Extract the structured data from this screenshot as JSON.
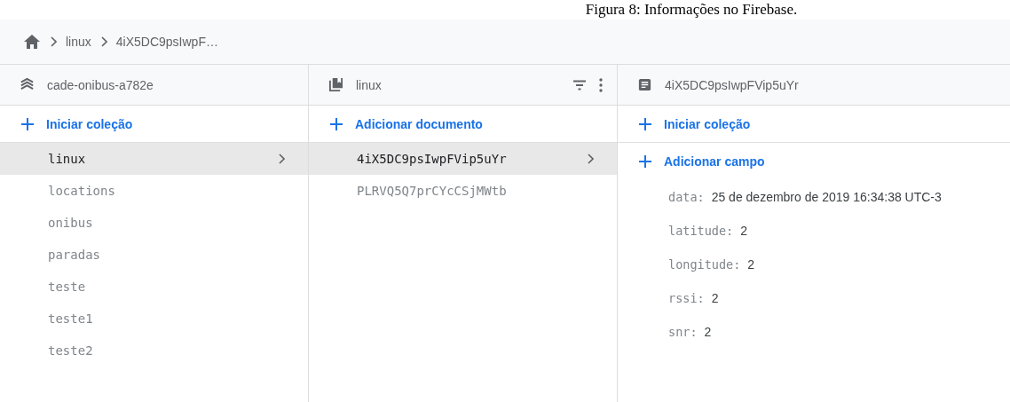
{
  "caption": "Figura 8: Informações no Firebase.",
  "breadcrumb": [
    {
      "label": "linux"
    },
    {
      "label": "4iX5DC9psIwpF…"
    }
  ],
  "panels": [
    {
      "kind": "project",
      "title": "cade-onibus-a782e",
      "action": "Iniciar coleção",
      "items": [
        {
          "label": "linux",
          "selected": true
        },
        {
          "label": "locations",
          "selected": false
        },
        {
          "label": "onibus",
          "selected": false
        },
        {
          "label": "paradas",
          "selected": false
        },
        {
          "label": "teste",
          "selected": false
        },
        {
          "label": "teste1",
          "selected": false
        },
        {
          "label": "teste2",
          "selected": false
        }
      ]
    },
    {
      "kind": "collection",
      "title": "linux",
      "action": "Adicionar documento",
      "items": [
        {
          "label": "4iX5DC9psIwpFVip5uYr",
          "selected": true
        },
        {
          "label": "PLRVQ5Q7prCYcCSjMWtb",
          "selected": false
        }
      ]
    },
    {
      "kind": "document",
      "title": "4iX5DC9psIwpFVip5uYr",
      "action": "Iniciar coleção",
      "field_action": "Adicionar campo",
      "fields": [
        {
          "key": "data:",
          "value": "25 de dezembro de 2019 16:34:38 UTC-3"
        },
        {
          "key": "latitude:",
          "value": "2"
        },
        {
          "key": "longitude:",
          "value": "2"
        },
        {
          "key": "rssi:",
          "value": "2"
        },
        {
          "key": "snr:",
          "value": "2"
        }
      ]
    }
  ]
}
